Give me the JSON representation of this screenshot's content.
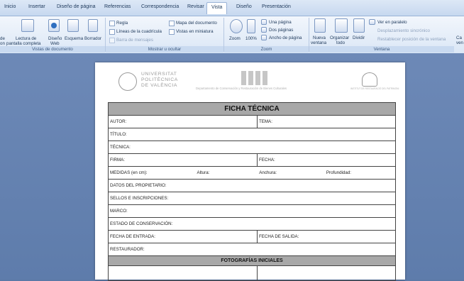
{
  "tabs": [
    "Inicio",
    "Insertar",
    "Diseño de página",
    "Referencias",
    "Correspondencia",
    "Revisar",
    "Vista",
    "Diseño",
    "Presentación"
  ],
  "ribbon": {
    "doc_views": {
      "cut_left_1": "de",
      "cut_left_2": "on",
      "lectura": "Lectura de",
      "pantalla": "pantalla completa",
      "diseno_web_1": "Diseño",
      "diseno_web_2": "Web",
      "esquema": "Esquema",
      "borrador": "Borrador",
      "group_label": "Vistas de documento"
    },
    "show": {
      "regla": "Regla",
      "lineas": "Líneas de la cuadrícula",
      "barra": "Barra de mensajes",
      "mapa": "Mapa del documento",
      "vistas": "Vistas en miniatura",
      "group_label": "Mostrar u ocultar"
    },
    "zoom": {
      "zoom": "Zoom",
      "cien": "100%",
      "una": "Una página",
      "dos": "Dos páginas",
      "ancho": "Ancho de página",
      "group_label": "Zoom"
    },
    "window": {
      "nueva_1": "Nueva",
      "nueva_2": "ventana",
      "organizar_1": "Organizar",
      "organizar_2": "todo",
      "dividir": "Dividir",
      "paralelo": "Ver en paralelo",
      "desplazamiento": "Desplazamiento sincrónico",
      "restablecer": "Restablecer posición de la ventana",
      "cut_right_1": "Ca",
      "cut_right_2": "ven",
      "group_label": "Ventana"
    }
  },
  "document": {
    "univ_1": "UNIVERSITAT",
    "univ_2": "POLITÈCNICA",
    "univ_3": "DE VALÈNCIA",
    "dept": "Departamento de Conservación y Restauración de Bienes Culturales",
    "inst": "INSTITUT DE RESTAURACIÓ DEL PATRIMONI",
    "ficha_title": "FICHA TÉCNICA",
    "autor": "AUTOR:",
    "tema": "TEMA:",
    "titulo": "TÍTULO:",
    "tecnica": "TÉCNICA:",
    "firma": "FIRMA:",
    "fecha": "FECHA:",
    "medidas": "MEDIDAS (en cm):",
    "altura": "Altura:",
    "anchura": "Anchura:",
    "profundidad": "Profundidad:",
    "propietario": "DATOS DEL PROPIETARIO:",
    "sellos": "SELLOS E INSCRIPCIONES:",
    "marco": "MARCO:",
    "estado": "ESTADO DE CONSERVACIÓN:",
    "entrada": "FECHA DE ENTRADA:",
    "salida": "FECHA DE SALIDA:",
    "restaurador": "RESTAURADOR:",
    "fotografias": "FOTOGRAFÍAS INICIALES"
  }
}
